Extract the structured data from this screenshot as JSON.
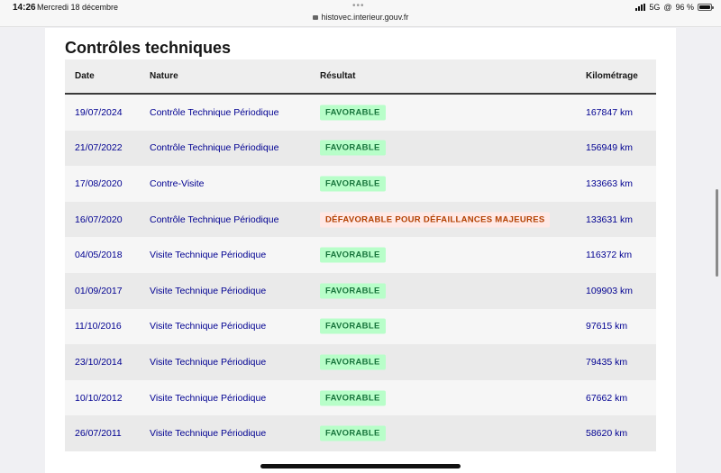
{
  "statusbar": {
    "time": "14:26",
    "date": "Mercredi 18 décembre",
    "url": "histovec.interieur.gouv.fr",
    "network": "5G",
    "battery": "96 %",
    "battery_level": 0.96
  },
  "page": {
    "title": "Contrôles techniques"
  },
  "table": {
    "headers": {
      "date": "Date",
      "nature": "Nature",
      "result": "Résultat",
      "km": "Kilométrage"
    },
    "rows": [
      {
        "date": "19/07/2024",
        "nature": "Contrôle Technique Périodique",
        "result": "FAVORABLE",
        "status": "ok",
        "km": "167847 km"
      },
      {
        "date": "21/07/2022",
        "nature": "Contrôle Technique Périodique",
        "result": "FAVORABLE",
        "status": "ok",
        "km": "156949 km"
      },
      {
        "date": "17/08/2020",
        "nature": "Contre-Visite",
        "result": "FAVORABLE",
        "status": "ok",
        "km": "133663 km"
      },
      {
        "date": "16/07/2020",
        "nature": "Contrôle Technique Périodique",
        "result": "DÉFAVORABLE POUR DÉFAILLANCES MAJEURES",
        "status": "ko",
        "km": "133631 km"
      },
      {
        "date": "04/05/2018",
        "nature": "Visite Technique Périodique",
        "result": "FAVORABLE",
        "status": "ok",
        "km": "116372 km"
      },
      {
        "date": "01/09/2017",
        "nature": "Visite Technique Périodique",
        "result": "FAVORABLE",
        "status": "ok",
        "km": "109903 km"
      },
      {
        "date": "11/10/2016",
        "nature": "Visite Technique Périodique",
        "result": "FAVORABLE",
        "status": "ok",
        "km": "97615 km"
      },
      {
        "date": "23/10/2014",
        "nature": "Visite Technique Périodique",
        "result": "FAVORABLE",
        "status": "ok",
        "km": "79435 km"
      },
      {
        "date": "10/10/2012",
        "nature": "Visite Technique Périodique",
        "result": "FAVORABLE",
        "status": "ok",
        "km": "67662 km"
      },
      {
        "date": "26/07/2011",
        "nature": "Visite Technique Périodique",
        "result": "FAVORABLE",
        "status": "ok",
        "km": "58620 km"
      }
    ]
  },
  "colors": {
    "link": "#000091",
    "favorable_bg": "#b8fec9",
    "favorable_text": "#18753c",
    "defavorable_bg": "#ffe9e6",
    "defavorable_text": "#b34000"
  }
}
